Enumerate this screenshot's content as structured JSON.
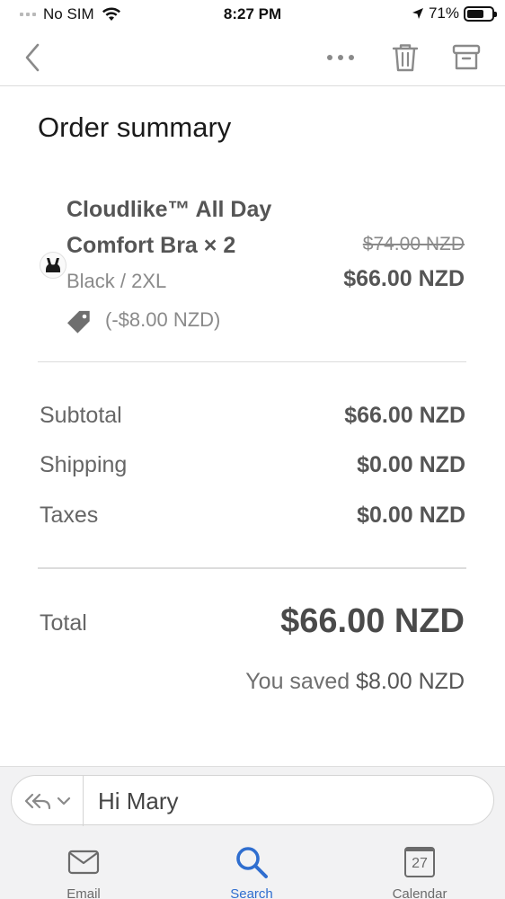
{
  "status_bar": {
    "carrier": "No SIM",
    "time": "8:27 PM",
    "battery_percent": "71%",
    "battery_level": 0.71
  },
  "nav": {
    "back_icon": "chevron-left-icon",
    "more_icon": "more-horizontal-icon",
    "delete_icon": "trash-icon",
    "archive_icon": "archive-icon"
  },
  "order": {
    "title": "Order summary",
    "item": {
      "name": "Cloudlike™ All Day Comfort Bra × 2",
      "variant": "Black / 2XL",
      "discount": "(-$8.00 NZD)",
      "original_price": "$74.00 NZD",
      "price": "$66.00 NZD"
    },
    "summary": [
      {
        "label": "Subtotal",
        "value": "$66.00 NZD"
      },
      {
        "label": "Shipping",
        "value": "$0.00 NZD"
      },
      {
        "label": "Taxes",
        "value": "$0.00 NZD"
      }
    ],
    "total_label": "Total",
    "total_value": "$66.00 NZD",
    "saved_prefix": "You saved",
    "saved_amount": "$8.00 NZD"
  },
  "reply": {
    "value": "Hi Mary"
  },
  "tabs": [
    {
      "label": "Email",
      "icon": "mail-icon"
    },
    {
      "label": "Search",
      "icon": "search-icon"
    },
    {
      "label": "Calendar",
      "icon": "calendar-icon",
      "day": "27"
    }
  ],
  "colors": {
    "accent": "#2f6ecf",
    "text_muted": "#8a8a8a"
  }
}
